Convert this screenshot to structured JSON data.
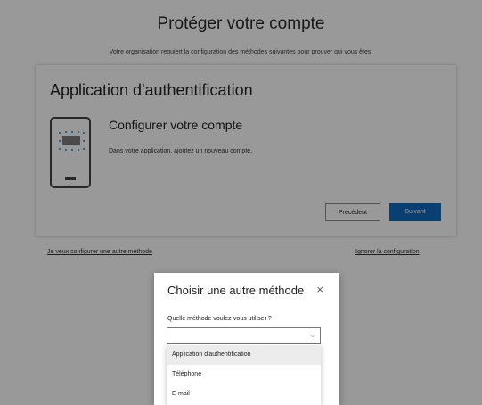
{
  "page": {
    "title": "Protéger votre compte",
    "subtitle": "Votre organisation requiert la configuration des méthodes suivantes pour prouver qui vous êtes."
  },
  "card": {
    "title": "Application d'authentification",
    "setup_title": "Configurer votre compte",
    "setup_desc": "Dans votre application, ajoutez un nouveau compte.",
    "prev_label": "Précédent",
    "next_label": "Suivant",
    "icon": "phone-icon"
  },
  "footer": {
    "other_method_link": "Je veux configurer une autre méthode",
    "skip_link": "Ignorer la configuration"
  },
  "dialog": {
    "title": "Choisir une autre méthode",
    "close_icon": "×",
    "question": "Quelle méthode voulez-vous utiliser ?",
    "select_value": "",
    "chevron_icon": "⌵",
    "options": [
      {
        "label": "Application d'authentification",
        "selected": true
      },
      {
        "label": "Téléphone",
        "selected": false
      },
      {
        "label": "E-mail",
        "selected": false
      }
    ]
  },
  "colors": {
    "accent": "#0f6cbd",
    "overlay": "rgba(0,0,0,0.4)"
  }
}
